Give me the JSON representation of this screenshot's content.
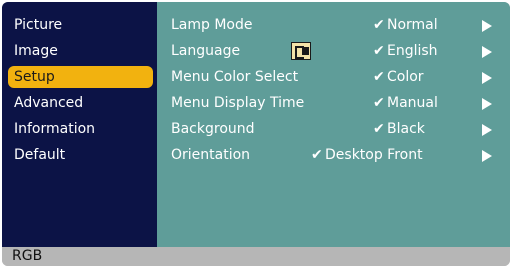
{
  "sidebar": {
    "items": [
      {
        "label": "Picture"
      },
      {
        "label": "Image"
      },
      {
        "label": "Setup"
      },
      {
        "label": "Advanced"
      },
      {
        "label": "Information"
      },
      {
        "label": "Default"
      }
    ],
    "selected_index": 2
  },
  "settings": {
    "rows": [
      {
        "label": "Lamp Mode",
        "value": "Normal"
      },
      {
        "label": "Language",
        "value": "English",
        "icon": "language-icon"
      },
      {
        "label": "Menu Color Select",
        "value": "Color"
      },
      {
        "label": "Menu Display Time",
        "value": "Manual"
      },
      {
        "label": "Background",
        "value": "Black"
      },
      {
        "label": "Orientation",
        "value": "Desktop Front"
      }
    ],
    "check_glyph": "✔"
  },
  "status": {
    "source": "RGB"
  },
  "colors": {
    "sidebar_bg": "#0c1346",
    "panel_bg": "#5f9d99",
    "selected_bg": "#f2b20f",
    "statusbar_bg": "#b6b6b6"
  }
}
